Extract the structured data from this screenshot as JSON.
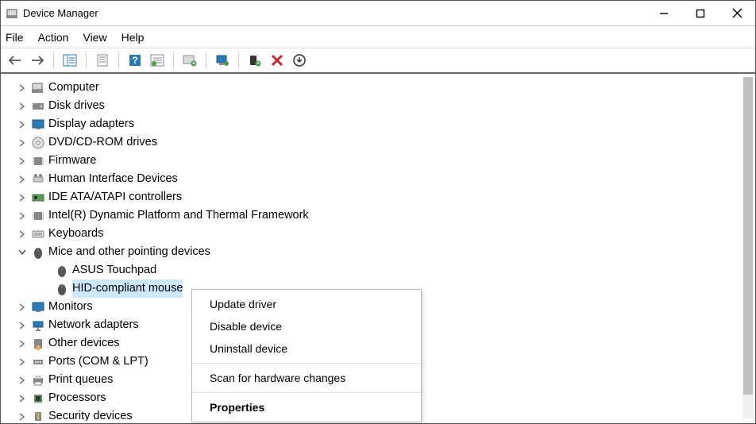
{
  "titlebar": {
    "title": "Device Manager"
  },
  "menubar": [
    "File",
    "Action",
    "View",
    "Help"
  ],
  "tree": [
    {
      "label": "Computer",
      "icon": "computer",
      "expand": "right"
    },
    {
      "label": "Disk drives",
      "icon": "disk",
      "expand": "right"
    },
    {
      "label": "Display adapters",
      "icon": "display",
      "expand": "right"
    },
    {
      "label": "DVD/CD-ROM drives",
      "icon": "disc",
      "expand": "right"
    },
    {
      "label": "Firmware",
      "icon": "chip",
      "expand": "right"
    },
    {
      "label": "Human Interface Devices",
      "icon": "hid",
      "expand": "right"
    },
    {
      "label": "IDE ATA/ATAPI controllers",
      "icon": "ide",
      "expand": "right"
    },
    {
      "label": "Intel(R) Dynamic Platform and Thermal Framework",
      "icon": "chip",
      "expand": "right"
    },
    {
      "label": "Keyboards",
      "icon": "keyboard",
      "expand": "right"
    },
    {
      "label": "Mice and other pointing devices",
      "icon": "mouse",
      "expand": "down"
    },
    {
      "label": "ASUS Touchpad",
      "icon": "mouse",
      "child": true,
      "expand": "none"
    },
    {
      "label": "HID-compliant mouse",
      "icon": "mouse",
      "child": true,
      "expand": "none",
      "selected": true
    },
    {
      "label": "Monitors",
      "icon": "monitor",
      "expand": "right"
    },
    {
      "label": "Network adapters",
      "icon": "network",
      "expand": "right"
    },
    {
      "label": "Other devices",
      "icon": "other",
      "expand": "right"
    },
    {
      "label": "Ports (COM & LPT)",
      "icon": "port",
      "expand": "right"
    },
    {
      "label": "Print queues",
      "icon": "printer",
      "expand": "right"
    },
    {
      "label": "Processors",
      "icon": "cpu",
      "expand": "right"
    },
    {
      "label": "Security devices",
      "icon": "security",
      "expand": "right"
    }
  ],
  "context_menu": [
    {
      "label": "Update driver"
    },
    {
      "label": "Disable device"
    },
    {
      "label": "Uninstall device"
    },
    {
      "sep": true
    },
    {
      "label": "Scan for hardware changes"
    },
    {
      "sep": true
    },
    {
      "label": "Properties",
      "bold": true
    }
  ]
}
